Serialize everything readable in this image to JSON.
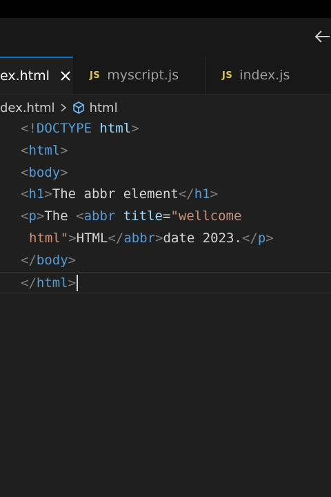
{
  "tabs": [
    {
      "label": "ex.html",
      "active": true,
      "icon": "close-icon"
    },
    {
      "label": "myscript.js",
      "badge": "JS"
    },
    {
      "label": "index.js",
      "badge": "JS"
    }
  ],
  "breadcrumb": {
    "file": "dex.html",
    "item": "html"
  },
  "code": {
    "doctype_open": "<!",
    "doctype_kw": "DOCTYPE",
    "doctype_attr": "html",
    "doctype_close": ">",
    "html": "html",
    "body": "body",
    "h1": "h1",
    "h1_text": "The abbr element",
    "p": "p",
    "p_text": "The ",
    "abbr": "abbr",
    "title_attr": "title",
    "equals": "=",
    "title_value_1": "\"wellcome",
    "title_value_2": "html\"",
    "abbr_text": "HTML",
    "after_abbr": "date 2023.",
    "lt": "<",
    "gt": ">",
    "lt_slash": "</",
    "space": " "
  },
  "colors": {
    "tag": "#569cd6",
    "attr": "#9cdcfe",
    "string": "#ce9178",
    "punct": "#808080",
    "accent": "#0078d4",
    "js": "#e8c94a"
  }
}
